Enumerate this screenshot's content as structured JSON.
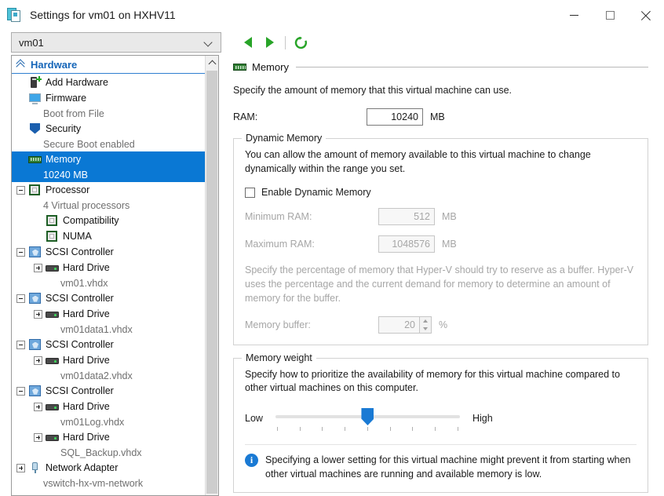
{
  "window": {
    "title": "Settings for vm01 on HXHV11",
    "icon": "settings-document-icon",
    "minimize_label": "Minimize",
    "maximize_label": "Maximize",
    "close_label": "Close"
  },
  "toolbar": {
    "vm_selected": "vm01",
    "back_label": "Back",
    "forward_label": "Forward",
    "refresh_label": "Refresh"
  },
  "sidebar": {
    "header": "Hardware",
    "items": [
      {
        "label": "Add Hardware",
        "sub": "",
        "icon": "add-hardware-icon",
        "expander": "none",
        "indent": 0,
        "selected": false
      },
      {
        "label": "Firmware",
        "sub": "Boot from File",
        "icon": "firmware-monitor-icon",
        "expander": "none",
        "indent": 0,
        "selected": false
      },
      {
        "label": "Security",
        "sub": "Secure Boot enabled",
        "icon": "security-shield-icon",
        "expander": "none",
        "indent": 0,
        "selected": false
      },
      {
        "label": "Memory",
        "sub": "10240 MB",
        "icon": "memory-icon",
        "expander": "none",
        "indent": 0,
        "selected": true
      },
      {
        "label": "Processor",
        "sub": "4 Virtual processors",
        "icon": "processor-icon",
        "expander": "minus",
        "indent": 0,
        "selected": false
      },
      {
        "label": "Compatibility",
        "sub": "",
        "icon": "processor-icon",
        "expander": "none",
        "indent": 1,
        "selected": false
      },
      {
        "label": "NUMA",
        "sub": "",
        "icon": "processor-icon",
        "expander": "none",
        "indent": 1,
        "selected": false
      },
      {
        "label": "SCSI Controller",
        "sub": "",
        "icon": "scsi-controller-icon",
        "expander": "minus",
        "indent": 0,
        "selected": false
      },
      {
        "label": "Hard Drive",
        "sub": "vm01.vhdx",
        "icon": "hard-drive-icon",
        "expander": "plus",
        "indent": 1,
        "selected": false
      },
      {
        "label": "SCSI Controller",
        "sub": "",
        "icon": "scsi-controller-icon",
        "expander": "minus",
        "indent": 0,
        "selected": false
      },
      {
        "label": "Hard Drive",
        "sub": "vm01data1.vhdx",
        "icon": "hard-drive-icon",
        "expander": "plus",
        "indent": 1,
        "selected": false
      },
      {
        "label": "SCSI Controller",
        "sub": "",
        "icon": "scsi-controller-icon",
        "expander": "minus",
        "indent": 0,
        "selected": false
      },
      {
        "label": "Hard Drive",
        "sub": "vm01data2.vhdx",
        "icon": "hard-drive-icon",
        "expander": "plus",
        "indent": 1,
        "selected": false
      },
      {
        "label": "SCSI Controller",
        "sub": "",
        "icon": "scsi-controller-icon",
        "expander": "minus",
        "indent": 0,
        "selected": false
      },
      {
        "label": "Hard Drive",
        "sub": "vm01Log.vhdx",
        "icon": "hard-drive-icon",
        "expander": "plus",
        "indent": 1,
        "selected": false
      },
      {
        "label": "Hard Drive",
        "sub": "SQL_Backup.vhdx",
        "icon": "hard-drive-icon",
        "expander": "plus",
        "indent": 1,
        "selected": false
      },
      {
        "label": "Network Adapter",
        "sub": "vswitch-hx-vm-network",
        "icon": "network-adapter-icon",
        "expander": "plus",
        "indent": 0,
        "selected": false
      }
    ]
  },
  "main": {
    "section_title": "Memory",
    "section_icon": "memory-icon",
    "intro": "Specify the amount of memory that this virtual machine can use.",
    "ram": {
      "label": "RAM:",
      "value": "10240",
      "unit": "MB"
    },
    "dynamic_memory": {
      "title": "Dynamic Memory",
      "description": "You can allow the amount of memory available to this virtual machine to change dynamically within the range you set.",
      "enable_label": "Enable Dynamic Memory",
      "enabled": false,
      "minimum": {
        "label": "Minimum RAM:",
        "value": "512",
        "unit": "MB"
      },
      "maximum": {
        "label": "Maximum RAM:",
        "value": "1048576",
        "unit": "MB"
      },
      "buffer_description": "Specify the percentage of memory that Hyper-V should try to reserve as a buffer. Hyper-V uses the percentage and the current demand for memory to determine an amount of memory for the buffer.",
      "buffer": {
        "label": "Memory buffer:",
        "value": "20",
        "unit": "%"
      }
    },
    "memory_weight": {
      "title": "Memory weight",
      "description": "Specify how to prioritize the availability of memory for this virtual machine compared to other virtual machines on this computer.",
      "low_label": "Low",
      "high_label": "High",
      "slider_position_percent": 50,
      "tick_count": 9
    },
    "info": {
      "icon": "info-icon",
      "text": "Specifying a lower setting for this virtual machine might prevent it from starting when other virtual machines are running and available memory is low."
    }
  },
  "colors": {
    "selection_blue": "#0a78d4",
    "header_blue": "#1565b8",
    "nav_green": "#28a428",
    "slider_blue": "#1a7ad4"
  }
}
